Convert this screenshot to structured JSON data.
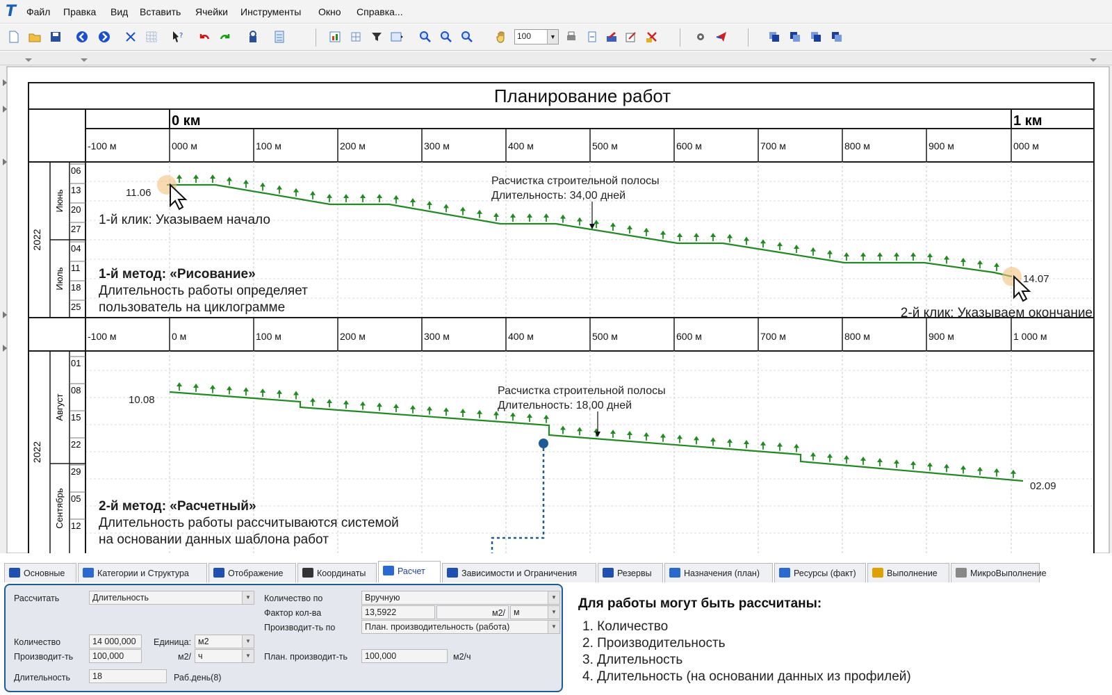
{
  "app": {
    "logo": "T",
    "menu": [
      "Файл",
      "Правка",
      "Вид",
      "Вставить",
      "Ячейки",
      "Инструменты",
      "Окно",
      "Справка..."
    ]
  },
  "toolbar": {
    "zoom_value": "100",
    "icons": [
      "new-file-icon",
      "open-folder-icon",
      "save-icon",
      "back-icon",
      "forward-icon",
      "cut-icon",
      "grid-icon",
      "help-icon",
      "undo-icon",
      "redo-icon",
      "lock-icon",
      "calc-icon",
      "chart-icon",
      "table-icon",
      "filter-icon",
      "layout-icon",
      "zoom-in-icon",
      "zoom-out-icon",
      "zoom-fit-icon",
      "hand-icon",
      "print-icon",
      "page-icon",
      "edit-icon",
      "edit2-icon",
      "delete-icon",
      "settings-icon",
      "export-icon",
      "layer1-icon",
      "layer2-icon",
      "layer3-icon",
      "layer4-icon"
    ]
  },
  "diagram": {
    "title": "Планирование работ",
    "chart1": {
      "km_start": "0 км",
      "km_end": "1 км",
      "distance_ticks": [
        "-100 м",
        "000 м",
        "100 м",
        "200 м",
        "300 м",
        "400 м",
        "500 м",
        "600 м",
        "700 м",
        "800 м",
        "900 м",
        "000 м"
      ],
      "year": "2022",
      "months": [
        "Июнь",
        "Июль"
      ],
      "days": [
        "06",
        "13",
        "20",
        "27",
        "04",
        "11",
        "18",
        "25"
      ],
      "start_label": "11.06",
      "end_label": "14.07",
      "task_name": "Расчистка строительной полосы",
      "task_duration": "Длительность: 34,00 дней",
      "click1": "1-й клик: Указываем начало",
      "click2": "2-й клик: Указываем окончание",
      "method_title": "1-й метод: «Рисование»",
      "method_text1": "Длительность работы определяет",
      "method_text2": "пользователь на циклограмме"
    },
    "chart2": {
      "distance_ticks": [
        "-100 м",
        "0 м",
        "100 м",
        "200 м",
        "300 м",
        "400 м",
        "500 м",
        "600 м",
        "700 м",
        "800 м",
        "900 м",
        "1 000 м"
      ],
      "year": "2022",
      "months": [
        "Август",
        "Сентябрь"
      ],
      "days": [
        "01",
        "08",
        "15",
        "22",
        "29",
        "05",
        "12"
      ],
      "start_label": "10.08",
      "end_label": "02.09",
      "task_name": "Расчистка строительной полосы",
      "task_duration": "Длительность: 18,00 дней",
      "method_title": "2-й метод: «Расчетный»",
      "method_text1": "Длительность работы рассчитываются системой",
      "method_text2": "на основании данных шаблона работ"
    }
  },
  "tabs": [
    {
      "label": "Основные",
      "color": "#1f4fb0"
    },
    {
      "label": "Категории и Структура",
      "color": "#2a6ad0"
    },
    {
      "label": "Отображение",
      "color": "#1f4fb0"
    },
    {
      "label": "Координаты",
      "color": "#333333"
    },
    {
      "label": "Расчет",
      "color": "#2a6ad0"
    },
    {
      "label": "Зависимости и Ограничения",
      "color": "#1f4fb0"
    },
    {
      "label": "Резервы",
      "color": "#1f4fb0"
    },
    {
      "label": "Назначения (план)",
      "color": "#2a6ad0"
    },
    {
      "label": "Ресурсы (факт)",
      "color": "#2a6ad0"
    },
    {
      "label": "Выполнение",
      "color": "#e0a000"
    },
    {
      "label": "МикроВыполнение",
      "color": "#888888"
    }
  ],
  "props": {
    "calc_label": "Рассчитать",
    "calc_value": "Длительность",
    "qty_by_label": "Количество по",
    "qty_by_value": "Вручную",
    "qty_factor_label": "Фактор кол-ва",
    "qty_factor_value": "13,5922",
    "qty_factor_unit": "м2/",
    "qty_factor_unit_sel": "м",
    "prod_by_label": "Производит-ть по",
    "prod_by_value": "План. производительность (работа)",
    "qty_label": "Количество",
    "qty_value": "14 000,000",
    "unit_label": "Единица:",
    "unit_value": "м2",
    "prod_label": "Производит-ть",
    "prod_value": "100,000",
    "prod_unit": "м2/",
    "prod_unit_sel": "ч",
    "plan_prod_label": "План. производит-ть",
    "plan_prod_value": "100,000",
    "plan_prod_unit": "м2/ч",
    "dur_label": "Длительность",
    "dur_value": "18",
    "dur_unit": "Раб.день(8)"
  },
  "calc_note": {
    "title": "Для работы могут быть рассчитаны:",
    "items": [
      "1. Количество",
      "2. Производительность",
      "3. Длительность",
      "4. Длительность (на основании данных из профилей)"
    ]
  },
  "colors": {
    "line": "#1f8a1f",
    "accent": "#1e5a96"
  }
}
